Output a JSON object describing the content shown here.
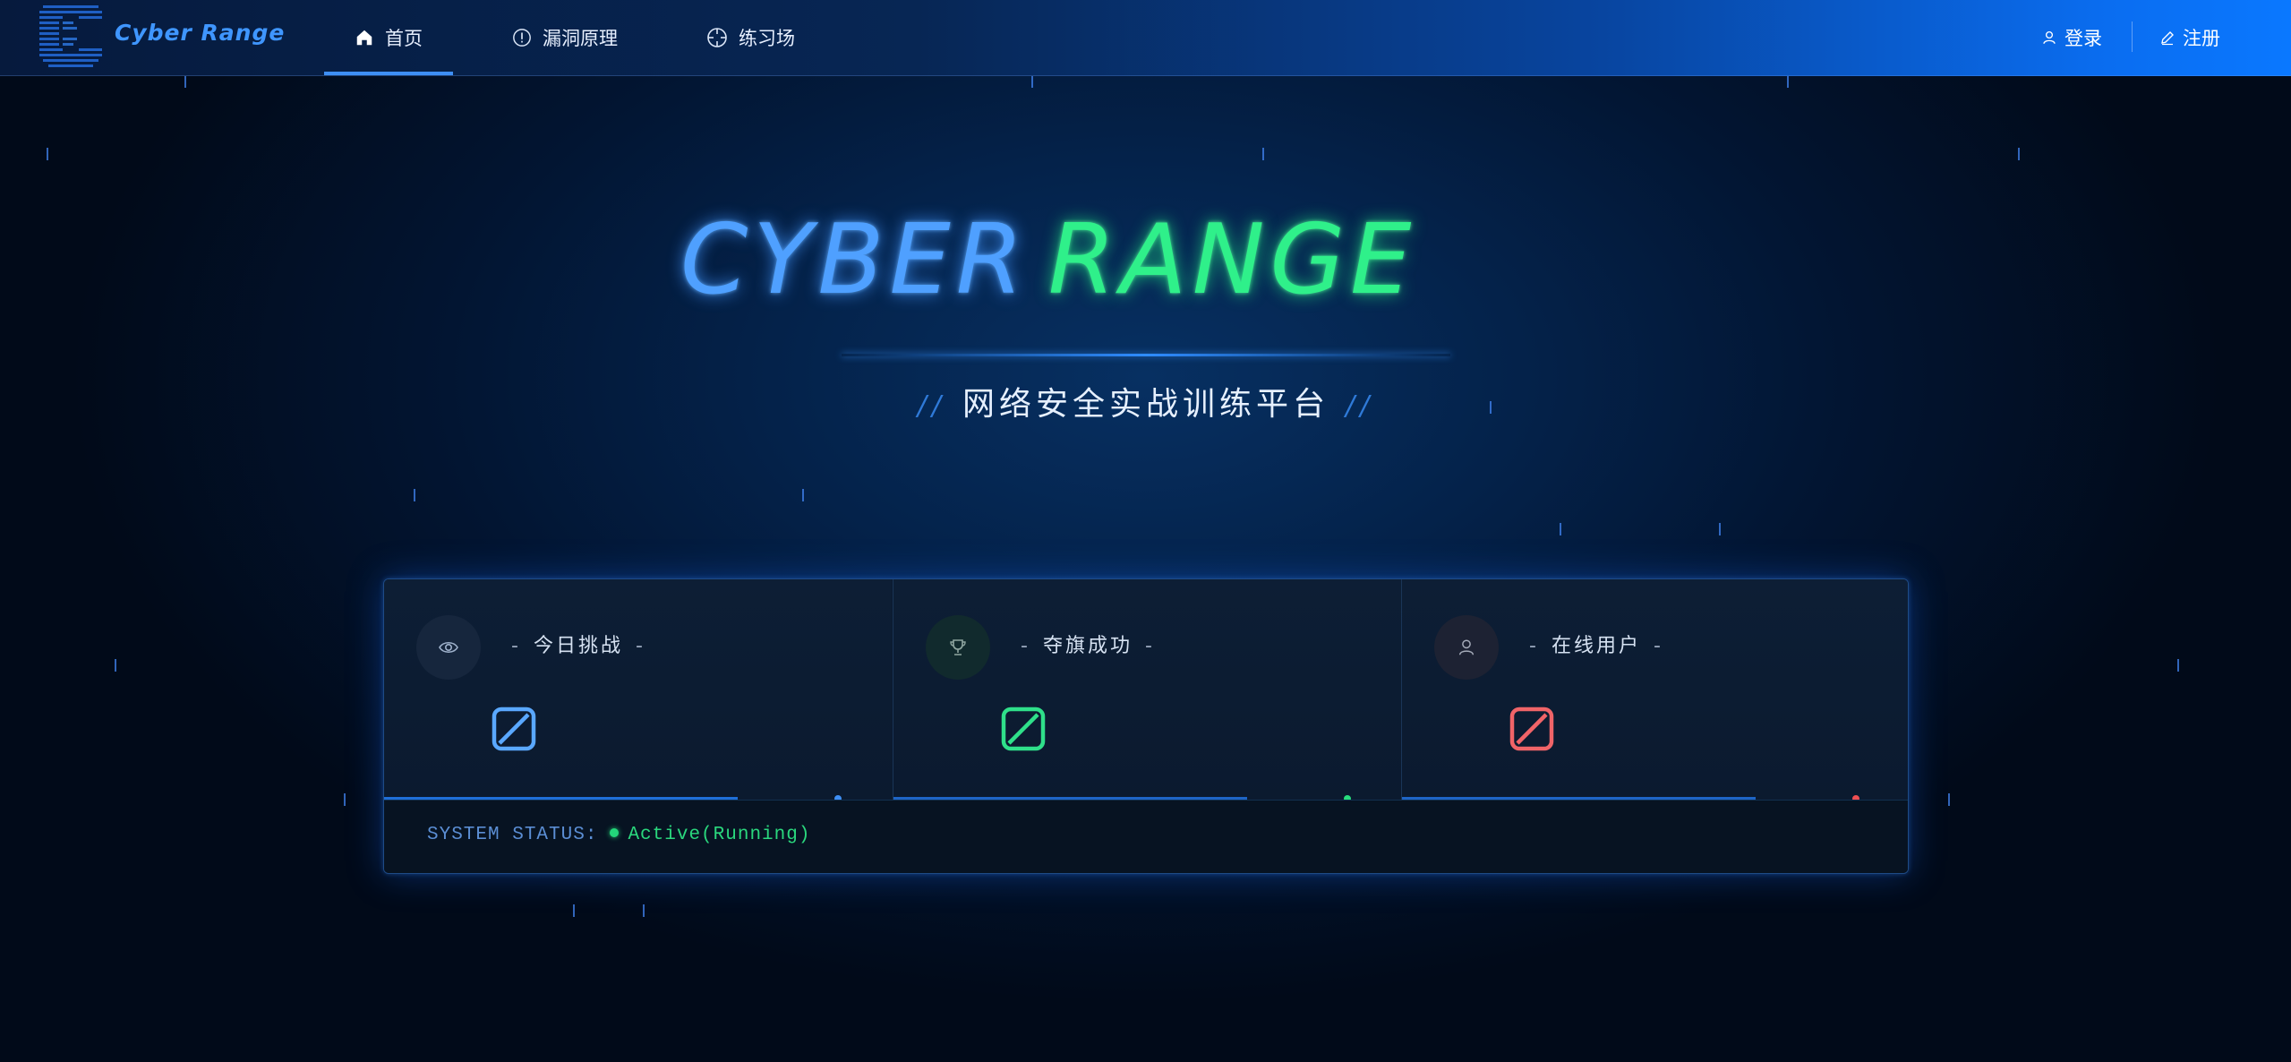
{
  "nav": {
    "brand": "Cyber Range",
    "items": [
      {
        "label": "首页",
        "icon": "home-icon",
        "active": true
      },
      {
        "label": "漏洞原理",
        "icon": "alert-circle-icon",
        "active": false
      },
      {
        "label": "练习场",
        "icon": "crosshair-icon",
        "active": false
      }
    ],
    "login_label": "登录",
    "register_label": "注册"
  },
  "hero": {
    "title_word1": "CYBER",
    "title_word2": "RANGE",
    "subtitle": "网络安全实战训练平台",
    "slash_left": "//",
    "slash_right": "//"
  },
  "stats": [
    {
      "label": "今日挑战",
      "icon": "eye-icon",
      "color": "#5aa8ff"
    },
    {
      "label": "夺旗成功",
      "icon": "trophy-icon",
      "color": "#2fe08a"
    },
    {
      "label": "在线用户",
      "icon": "user-icon",
      "color": "#f06468"
    }
  ],
  "stat_dash": "-",
  "status": {
    "label": "SYSTEM STATUS:",
    "value": "Active(Running)"
  },
  "colors": {
    "accent_blue": "#3e8ff5",
    "accent_green": "#2ff08a",
    "accent_red": "#ef4f52"
  }
}
